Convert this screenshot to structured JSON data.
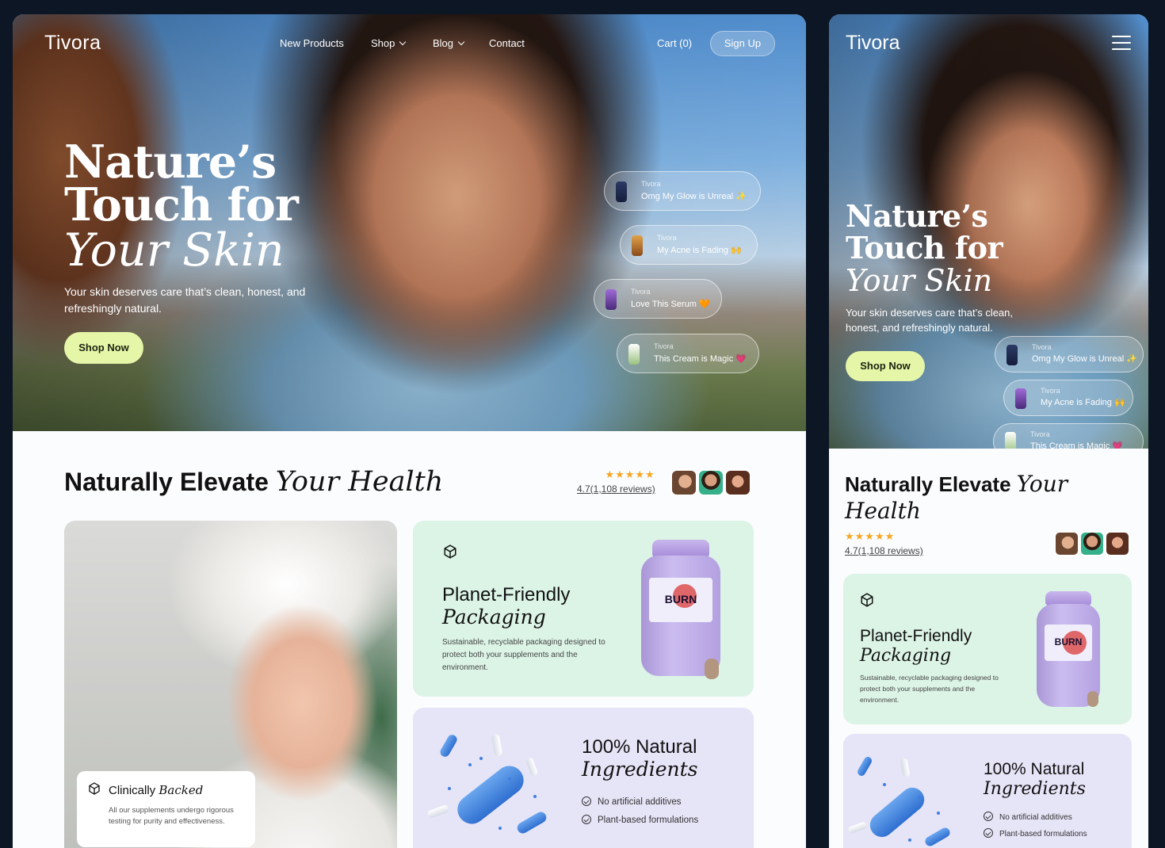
{
  "desktop": {
    "nav": {
      "logo": "Tivora",
      "links": [
        "New Products",
        "Shop",
        "Blog",
        "Contact"
      ],
      "cart": "Cart (0)",
      "signup": "Sign Up"
    },
    "hero": {
      "line1": "Nature’s",
      "line2": "Touch for",
      "line3": "Your Skin",
      "subtitle": "Your skin deserves care that’s clean, honest, and refreshingly natural.",
      "cta": "Shop Now"
    },
    "reviews": [
      {
        "brand": "Tivora",
        "text": "Omg My Glow is Unreal",
        "emoji": "✨"
      },
      {
        "brand": "Tivora",
        "text": "My Acne is Fading",
        "emoji": "🙌"
      },
      {
        "brand": "Tivora",
        "text": "Love This Serum",
        "emoji": "🧡"
      },
      {
        "brand": "Tivora",
        "text": "This Cream is Magic",
        "emoji": "💗"
      }
    ],
    "section": {
      "title_plain": "Naturally Elevate",
      "title_italic": "Your Health",
      "stars": "★★★★★",
      "rating": "4.7(1,108 reviews)"
    },
    "image_card": {
      "badge_title_plain": "Clinically",
      "badge_title_italic": "Backed",
      "badge_desc": "All our supplements undergo rigorous testing for purity and effectiveness."
    },
    "card_packaging": {
      "title_plain": "Planet-Friendly",
      "title_italic": "Packaging",
      "desc": "Sustainable, recyclable packaging designed to protect both your supplements and the environment.",
      "bottle_label": "BURN"
    },
    "card_ingredients": {
      "title_plain": "100% Natural",
      "title_italic": "Ingredients",
      "checks": [
        "No artificial additives",
        "Plant-based formulations"
      ]
    }
  },
  "mobile": {
    "logo": "Tivora",
    "hero": {
      "line1": "Nature’s",
      "line2": "Touch for",
      "line3": "Your Skin",
      "subtitle": "Your skin deserves care that’s clean, honest, and refreshingly natural.",
      "cta": "Shop Now"
    },
    "reviews": [
      {
        "brand": "Tivora",
        "text": "Omg My Glow is Unreal",
        "emoji": "✨"
      },
      {
        "brand": "Tivora",
        "text": "My Acne is Fading",
        "emoji": "🙌"
      },
      {
        "brand": "Tivora",
        "text": "This Cream is Magic",
        "emoji": "💗"
      }
    ],
    "section": {
      "title_plain": "Naturally Elevate",
      "title_italic": "Your Health",
      "stars": "★★★★★",
      "rating": "4.7(1,108 reviews)"
    },
    "card_packaging": {
      "title_plain": "Planet-Friendly",
      "title_italic": "Packaging",
      "desc": "Sustainable, recyclable packaging designed to protect both your supplements and the environment.",
      "bottle_label": "BURN"
    },
    "card_ingredients": {
      "title_plain": "100% Natural",
      "title_italic": "Ingredients",
      "checks": [
        "No artificial additives",
        "Plant-based formulations"
      ]
    }
  },
  "colors": {
    "page_bg": "#0c1624",
    "cta_lime": "#e6f6a8",
    "card_green": "#dcf4e6",
    "card_lavender": "#e6e4f7",
    "star": "#f6a623"
  }
}
